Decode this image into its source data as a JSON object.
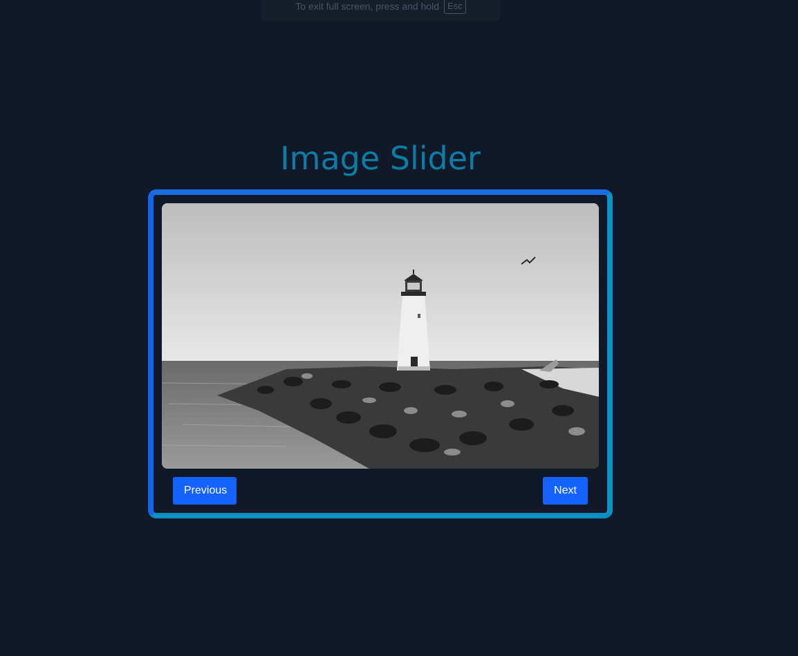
{
  "fullscreen_notice": {
    "text": "To exit full screen, press and hold",
    "key": "Esc"
  },
  "page": {
    "title": "Image Slider"
  },
  "slider": {
    "image_description": "lighthouse-photo",
    "previous_label": "Previous",
    "next_label": "Next"
  },
  "colors": {
    "background": "#111827",
    "title": "#0b7da6",
    "button": "#1462ff",
    "frame_border": "#1a6ee0"
  }
}
